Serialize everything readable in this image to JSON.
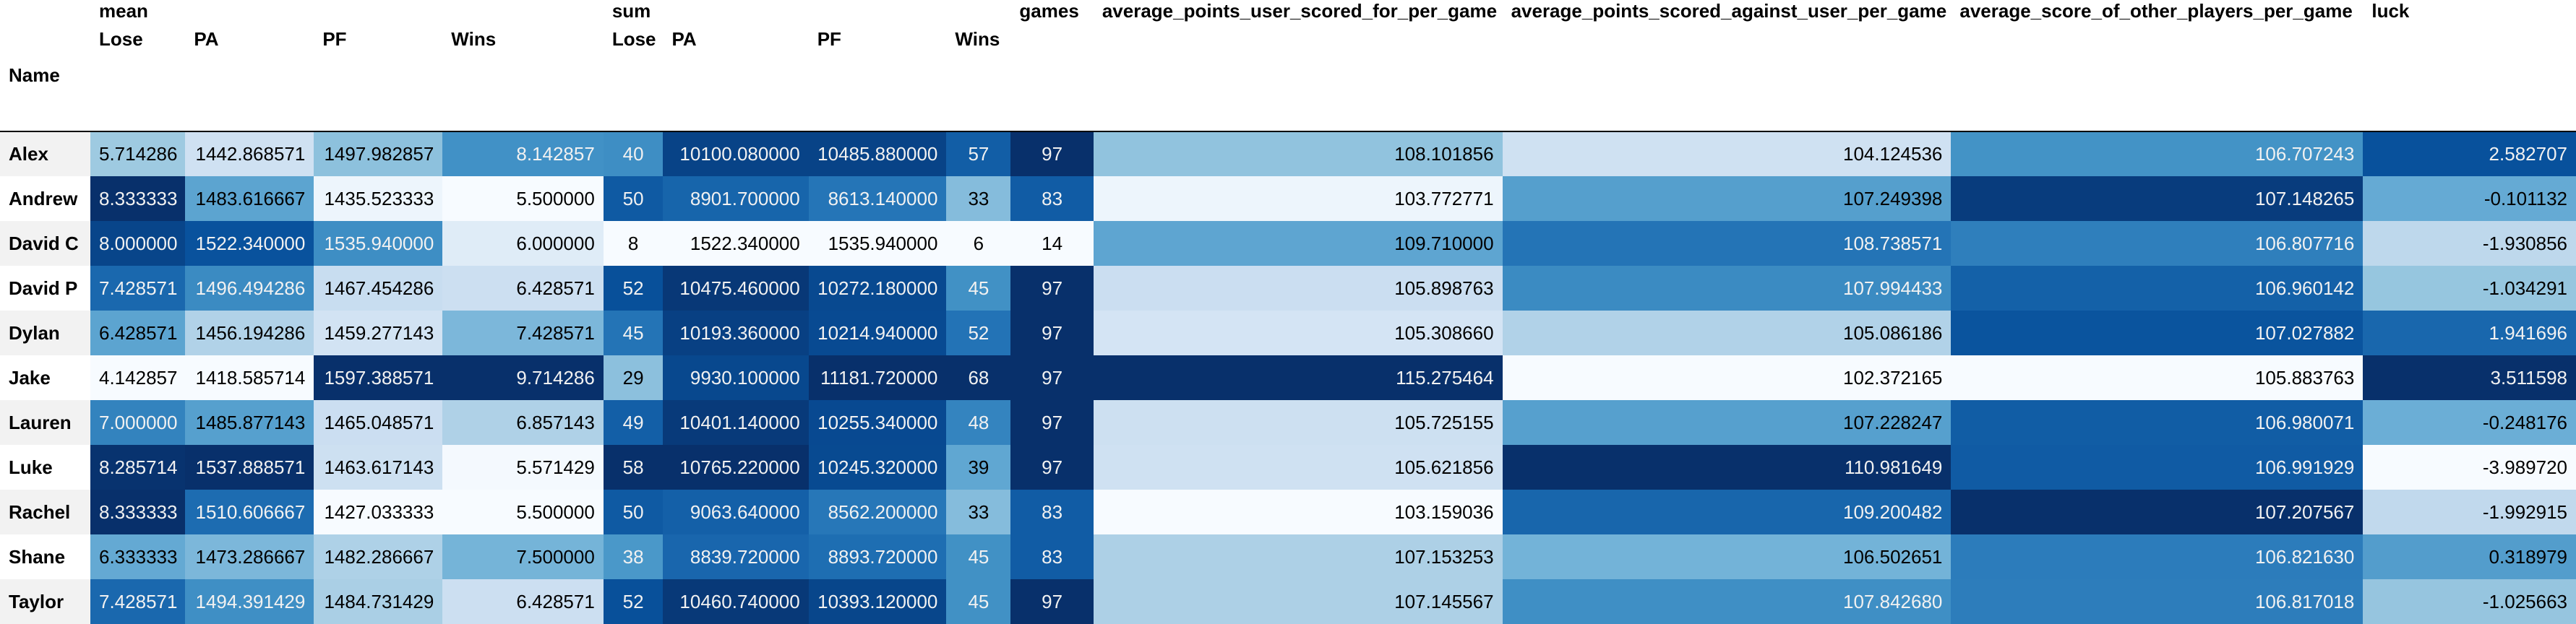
{
  "table": {
    "index_name": "Name",
    "top_headers": [
      {
        "label": "mean",
        "span": 4
      },
      {
        "label": "sum",
        "span": 4
      },
      {
        "label": "games",
        "span": 1
      },
      {
        "label": "average_points_user_scored_for_per_game",
        "span": 1
      },
      {
        "label": "average_points_scored_against_user_per_game",
        "span": 1
      },
      {
        "label": "average_score_of_other_players_per_game",
        "span": 1
      },
      {
        "label": "luck",
        "span": 1
      }
    ],
    "sub_headers": [
      "Lose",
      "PA",
      "PF",
      "Wins",
      "Lose",
      "PA",
      "PF",
      "Wins",
      "",
      "",
      "",
      "",
      ""
    ],
    "rows": [
      {
        "name": "Alex",
        "cells": [
          "5.714286",
          "1442.868571",
          "1497.982857",
          "8.142857",
          "40",
          "10100.080000",
          "10485.880000",
          "57",
          "97",
          "108.101856",
          "104.124536",
          "106.707243",
          "2.582707"
        ]
      },
      {
        "name": "Andrew",
        "cells": [
          "8.333333",
          "1483.616667",
          "1435.523333",
          "5.500000",
          "50",
          "8901.700000",
          "8613.140000",
          "33",
          "83",
          "103.772771",
          "107.249398",
          "107.148265",
          "-0.101132"
        ]
      },
      {
        "name": "David C",
        "cells": [
          "8.000000",
          "1522.340000",
          "1535.940000",
          "6.000000",
          "8",
          "1522.340000",
          "1535.940000",
          "6",
          "14",
          "109.710000",
          "108.738571",
          "106.807716",
          "-1.930856"
        ]
      },
      {
        "name": "David P",
        "cells": [
          "7.428571",
          "1496.494286",
          "1467.454286",
          "6.428571",
          "52",
          "10475.460000",
          "10272.180000",
          "45",
          "97",
          "105.898763",
          "107.994433",
          "106.960142",
          "-1.034291"
        ]
      },
      {
        "name": "Dylan",
        "cells": [
          "6.428571",
          "1456.194286",
          "1459.277143",
          "7.428571",
          "45",
          "10193.360000",
          "10214.940000",
          "52",
          "97",
          "105.308660",
          "105.086186",
          "107.027882",
          "1.941696"
        ]
      },
      {
        "name": "Jake",
        "cells": [
          "4.142857",
          "1418.585714",
          "1597.388571",
          "9.714286",
          "29",
          "9930.100000",
          "11181.720000",
          "68",
          "97",
          "115.275464",
          "102.372165",
          "105.883763",
          "3.511598"
        ]
      },
      {
        "name": "Lauren",
        "cells": [
          "7.000000",
          "1485.877143",
          "1465.048571",
          "6.857143",
          "49",
          "10401.140000",
          "10255.340000",
          "48",
          "97",
          "105.725155",
          "107.228247",
          "106.980071",
          "-0.248176"
        ]
      },
      {
        "name": "Luke",
        "cells": [
          "8.285714",
          "1537.888571",
          "1463.617143",
          "5.571429",
          "58",
          "10765.220000",
          "10245.320000",
          "39",
          "97",
          "105.621856",
          "110.981649",
          "106.991929",
          "-3.989720"
        ]
      },
      {
        "name": "Rachel",
        "cells": [
          "8.333333",
          "1510.606667",
          "1427.033333",
          "5.500000",
          "50",
          "9063.640000",
          "8562.200000",
          "33",
          "83",
          "103.159036",
          "109.200482",
          "107.207567",
          "-1.992915"
        ]
      },
      {
        "name": "Shane",
        "cells": [
          "6.333333",
          "1473.286667",
          "1482.286667",
          "7.500000",
          "38",
          "8839.720000",
          "8893.720000",
          "45",
          "83",
          "107.153253",
          "106.502651",
          "106.821630",
          "0.318979"
        ]
      },
      {
        "name": "Taylor",
        "cells": [
          "7.428571",
          "1494.391429",
          "1484.731429",
          "6.428571",
          "52",
          "10460.740000",
          "10393.120000",
          "45",
          "97",
          "107.145567",
          "107.842680",
          "106.817018",
          "-1.025663"
        ]
      }
    ],
    "colormap": [
      "#f7fbff",
      "#deebf7",
      "#c6dbef",
      "#9ecae1",
      "#6baed6",
      "#4292c6",
      "#2171b5",
      "#08519c",
      "#08306b"
    ]
  }
}
